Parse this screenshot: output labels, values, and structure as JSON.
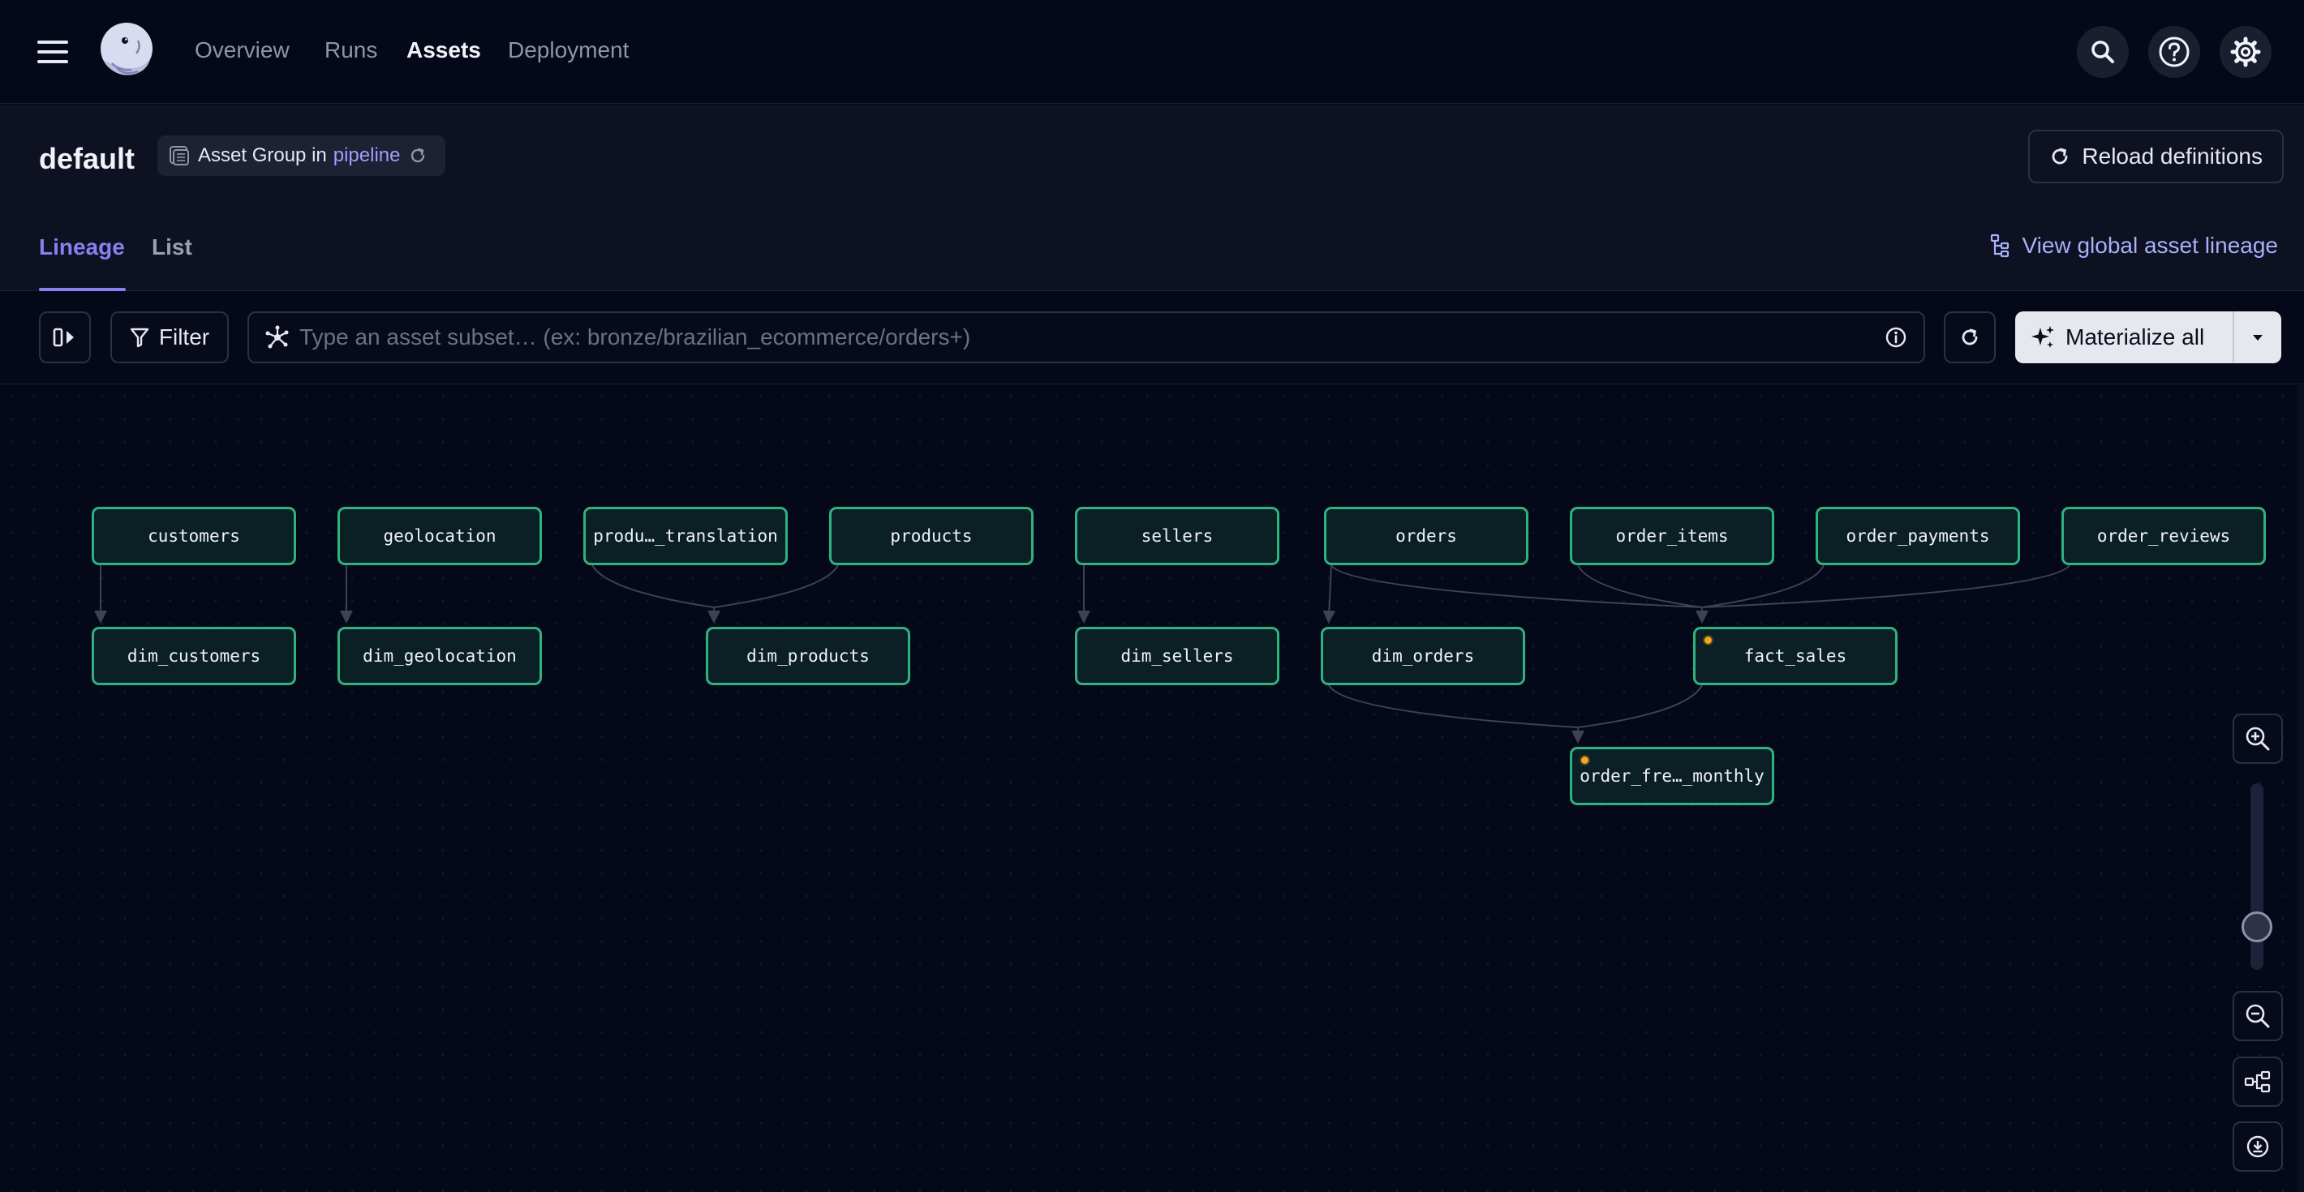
{
  "nav": {
    "items": [
      "Overview",
      "Runs",
      "Assets",
      "Deployment"
    ],
    "active": "Assets"
  },
  "header": {
    "title": "default",
    "group_tag_prefix": "Asset Group in",
    "group_tag_location": "pipeline",
    "reload_label": "Reload definitions"
  },
  "tabs": {
    "lineage": "Lineage",
    "list": "List",
    "active": "Lineage",
    "global_lineage_label": "View global asset lineage"
  },
  "toolbar": {
    "filter_label": "Filter",
    "search_placeholder": "Type an asset subset… (ex: bronze/brazilian_ecommerce/orders+)",
    "materialize_label": "Materialize all"
  },
  "graph": {
    "nodes": {
      "customers": "customers",
      "geolocation": "geolocation",
      "product_translation": "produ…_translation",
      "products": "products",
      "sellers": "sellers",
      "orders": "orders",
      "order_items": "order_items",
      "order_payments": "order_payments",
      "order_reviews": "order_reviews",
      "dim_customers": "dim_customers",
      "dim_geolocation": "dim_geolocation",
      "dim_products": "dim_products",
      "dim_sellers": "dim_sellers",
      "dim_orders": "dim_orders",
      "fact_sales": "fact_sales",
      "order_monthly": "order_fre…_monthly"
    },
    "status_dot_color": "#f5a524",
    "node_border_color": "#2fb27d"
  },
  "colors": {
    "accent": "#8b7ff0",
    "link": "#a49cf7",
    "background": "#050818"
  }
}
